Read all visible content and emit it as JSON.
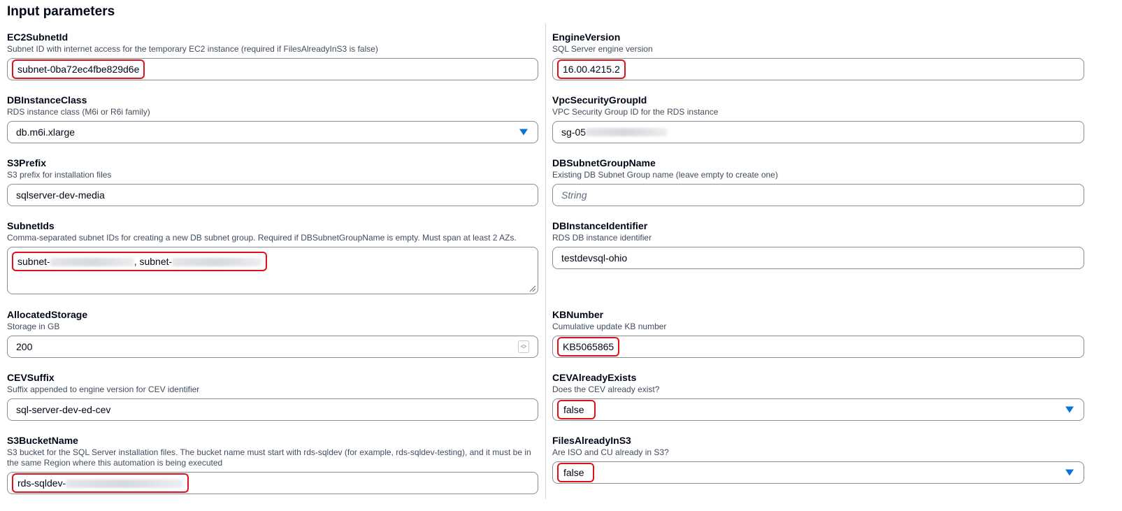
{
  "section": {
    "title": "Input parameters"
  },
  "left": {
    "ec2subnet": {
      "label": "EC2SubnetId",
      "desc": "Subnet ID with internet access for the temporary EC2 instance (required if FilesAlreadyInS3 is false)",
      "value": "subnet-0ba72ec4fbe829d6e"
    },
    "dbclass": {
      "label": "DBInstanceClass",
      "desc": "RDS instance class (M6i or R6i family)",
      "value": "db.m6i.xlarge"
    },
    "s3prefix": {
      "label": "S3Prefix",
      "desc": "S3 prefix for installation files",
      "value": "sqlserver-dev-media"
    },
    "subnetids": {
      "label": "SubnetIds",
      "desc": "Comma-separated subnet IDs for creating a new DB subnet group. Required if DBSubnetGroupName is empty. Must span at least 2 AZs.",
      "value_part1": "subnet-",
      "value_part2": ", subnet-"
    },
    "storage": {
      "label": "AllocatedStorage",
      "desc": "Storage in GB",
      "value": "200"
    },
    "cevsuffix": {
      "label": "CEVSuffix",
      "desc": "Suffix appended to engine version for CEV identifier",
      "value": "sql-server-dev-ed-cev"
    },
    "s3bucket": {
      "label": "S3BucketName",
      "desc": "S3 bucket for the SQL Server installation files. The bucket name must start with rds-sqldev (for example, rds-sqldev-testing), and it must be in the same Region where this automation is being executed",
      "value": "rds-sqldev-"
    }
  },
  "right": {
    "engine": {
      "label": "EngineVersion",
      "desc": "SQL Server engine version",
      "value": "16.00.4215.2"
    },
    "vpcsg": {
      "label": "VpcSecurityGroupId",
      "desc": "VPC Security Group ID for the RDS instance",
      "value": "sg-05"
    },
    "subnetgroup": {
      "label": "DBSubnetGroupName",
      "desc": "Existing DB Subnet Group name (leave empty to create one)",
      "placeholder": "String"
    },
    "dbid": {
      "label": "DBInstanceIdentifier",
      "desc": "RDS DB instance identifier",
      "value": "testdevsql-ohio"
    },
    "kb": {
      "label": "KBNumber",
      "desc": "Cumulative update KB number",
      "value": "KB5065865"
    },
    "cevexists": {
      "label": "CEVAlreadyExists",
      "desc": "Does the CEV already exist?",
      "value": "false"
    },
    "filesins3": {
      "label": "FilesAlreadyInS3",
      "desc": "Are ISO and CU already in S3?",
      "value": "false"
    }
  },
  "icons": {
    "dropdown": "caret-down-icon",
    "stepper": "number-stepper-icon",
    "resize": "resize-handle-icon"
  },
  "colors": {
    "accent": "#0972d3",
    "highlight": "#e0101a",
    "text": "#000716",
    "muted": "#414d5c"
  }
}
